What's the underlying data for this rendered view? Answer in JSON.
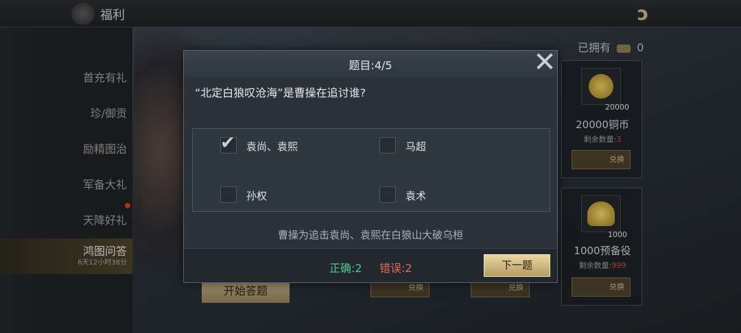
{
  "header": {
    "title": "福利",
    "logo_icon": "dragon-logo-icon"
  },
  "sidebar": {
    "items": [
      {
        "label": "首充有礼"
      },
      {
        "label": "珍/御贡"
      },
      {
        "label": "励精图治"
      },
      {
        "label": "军备大礼"
      },
      {
        "label": "天降好礼"
      },
      {
        "label": "鸿图问答",
        "sub": "6天12小时38分"
      }
    ]
  },
  "main": {
    "owned_label": "已拥有",
    "owned_count": "0",
    "start_button": "开始答题",
    "cards": [
      {
        "qty": "20000",
        "name": "20000铜币",
        "remain_label": "剩余数量:",
        "remain_value": "3",
        "exchange": "兑换"
      },
      {
        "qty": "1000",
        "name": "1000预备役",
        "remain_label": "剩余数量:",
        "remain_value": "999",
        "exchange": "兑换"
      }
    ],
    "bg_exchange": "兑换"
  },
  "dialog": {
    "title": "题目:4/5",
    "question": "“北定白狼叹沧海”是曹操在追讨谁?",
    "options": [
      {
        "label": "袁尚、袁熙",
        "checked": true
      },
      {
        "label": "马超",
        "checked": false
      },
      {
        "label": "孙权",
        "checked": false
      },
      {
        "label": "袁术",
        "checked": false
      }
    ],
    "explanation": "曹操为追击袁尚、袁熙在白狼山大破乌桓",
    "correct": "正确:2",
    "wrong": "错误:2",
    "next_button": "下一题"
  },
  "colors": {
    "correct": "#4fc98a",
    "wrong": "#e26a5a",
    "accent": "#e9d7a3"
  }
}
